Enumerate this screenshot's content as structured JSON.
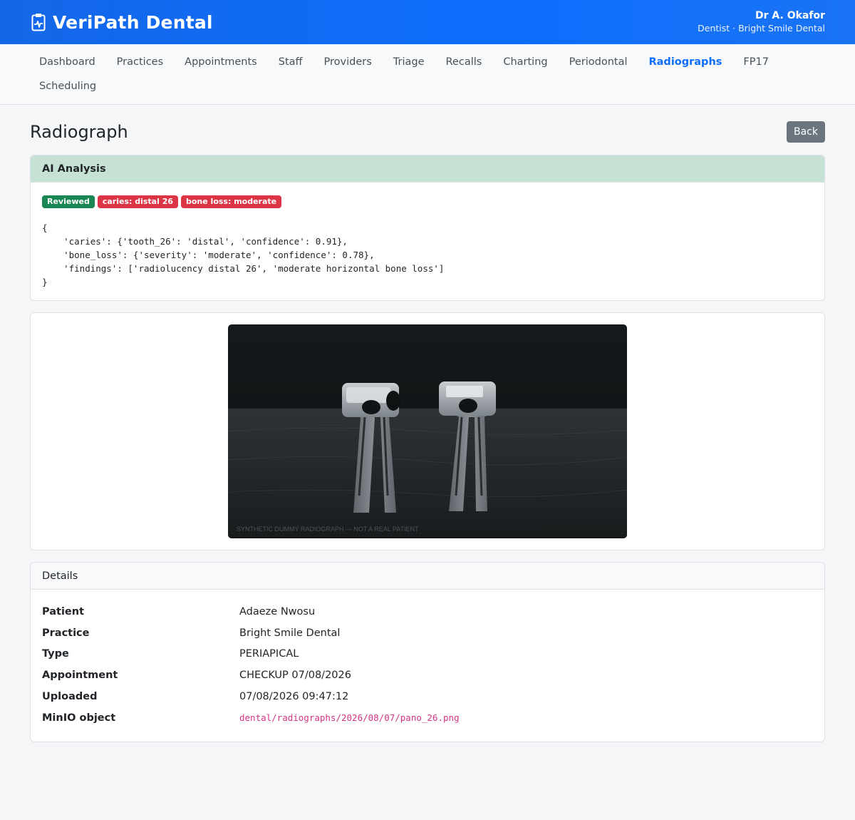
{
  "app": {
    "name": "VeriPath Dental",
    "user_name": "Dr A. Okafor",
    "user_role": "Dentist · Bright Smile Dental"
  },
  "nav": {
    "items": [
      {
        "label": "Dashboard"
      },
      {
        "label": "Practices"
      },
      {
        "label": "Appointments"
      },
      {
        "label": "Staff"
      },
      {
        "label": "Providers"
      },
      {
        "label": "Triage"
      },
      {
        "label": "Recalls"
      },
      {
        "label": "Charting"
      },
      {
        "label": "Periodontal"
      },
      {
        "label": "Radiographs",
        "active": true
      },
      {
        "label": "FP17"
      },
      {
        "label": "Scheduling"
      }
    ]
  },
  "page": {
    "title": "Radiograph",
    "back_label": "Back"
  },
  "ai": {
    "header": "AI Analysis",
    "badges": [
      {
        "label": "Reviewed",
        "color": "#198754"
      },
      {
        "label": "caries: distal 26",
        "color": "#dc3545"
      },
      {
        "label": "bone loss: moderate",
        "color": "#dc3545"
      }
    ],
    "json_text": "{\n    'caries': {'tooth_26': 'distal', 'confidence': 0.91},\n    'bone_loss': {'severity': 'moderate', 'confidence': 0.78},\n    'findings': ['radiolucency distal 26', 'moderate horizontal bone loss']\n}"
  },
  "image": {
    "watermark": "SYNTHETIC DUMMY RADIOGRAPH — NOT A REAL PATIENT"
  },
  "details": {
    "header": "Details",
    "rows": [
      {
        "label": "Patient",
        "value": "Adaeze Nwosu"
      },
      {
        "label": "Practice",
        "value": "Bright Smile Dental"
      },
      {
        "label": "Type",
        "value": "PERIAPICAL"
      },
      {
        "label": "Appointment",
        "value": "CHECKUP 07/08/2026"
      },
      {
        "label": "Uploaded",
        "value": "07/08/2026 09:47:12"
      },
      {
        "label": "MinIO object",
        "value": "dental/radiographs/2026/08/07/pano_26.png"
      }
    ]
  },
  "colors": {
    "primary": "#0d6efd",
    "success": "#198754",
    "danger": "#dc3545",
    "secondary": "#6c757d",
    "ai_header_bg": "#c5e2d4"
  }
}
